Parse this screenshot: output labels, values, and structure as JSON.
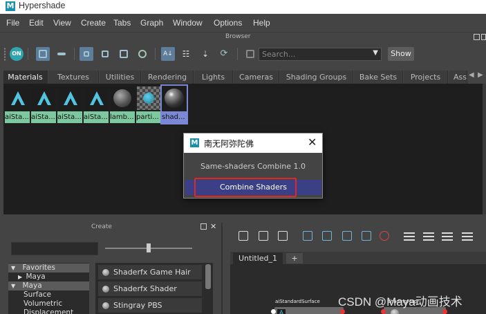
{
  "window": {
    "title": "Hypershade",
    "app_icon": "maya-icon"
  },
  "menubar": [
    "File",
    "Edit",
    "View",
    "Create",
    "Tabs",
    "Graph",
    "Window",
    "Options",
    "Help"
  ],
  "browser": {
    "panel_label": "Browser",
    "search_placeholder": "Search...",
    "show_label": "Show",
    "toggle_label": "ON",
    "tabs": [
      "Materials",
      "Textures",
      "Utilities",
      "Rendering",
      "Lights",
      "Cameras",
      "Shading Groups",
      "Bake Sets",
      "Projects",
      "Asse"
    ],
    "active_tab": "Materials",
    "swatches": [
      {
        "label": "aiSta...",
        "kind": "ai-standard-icon"
      },
      {
        "label": "aiSta...",
        "kind": "ai-standard-icon"
      },
      {
        "label": "aiSta...",
        "kind": "ai-standard-icon"
      },
      {
        "label": "aiSta...",
        "kind": "ai-standard-icon"
      },
      {
        "label": "lamb...",
        "kind": "lambert-ball"
      },
      {
        "label": "parti...",
        "kind": "particle-checker"
      },
      {
        "label": "shad...",
        "kind": "shader-ball",
        "selected": true
      }
    ]
  },
  "create": {
    "panel_label": "Create",
    "tree": [
      "Favorites",
      "Maya",
      "Maya",
      "Surface",
      "Volumetric",
      "Displacement"
    ],
    "list": [
      "Shaderfx Game Hair",
      "Shaderfx Shader",
      "Stingray PBS"
    ]
  },
  "node_editor": {
    "tab_label": "Untitled_1",
    "add_tab": "+",
    "node1_title": "aiStandardSurface",
    "node2_title": "shadingMap"
  },
  "dialog": {
    "title": "南无阿弥陀佛",
    "subtitle": "Same-shaders Combine 1.0",
    "button": "Combine Shaders",
    "close_glyph": "✕"
  },
  "watermark": "CSDN @Maya动画技术",
  "colors": {
    "accent": "#5d7d9a",
    "material_label": "#7ec8a0",
    "selected_label": "#7a88d6",
    "dialog_button": "#3a3f86",
    "highlight": "#e2272a"
  }
}
